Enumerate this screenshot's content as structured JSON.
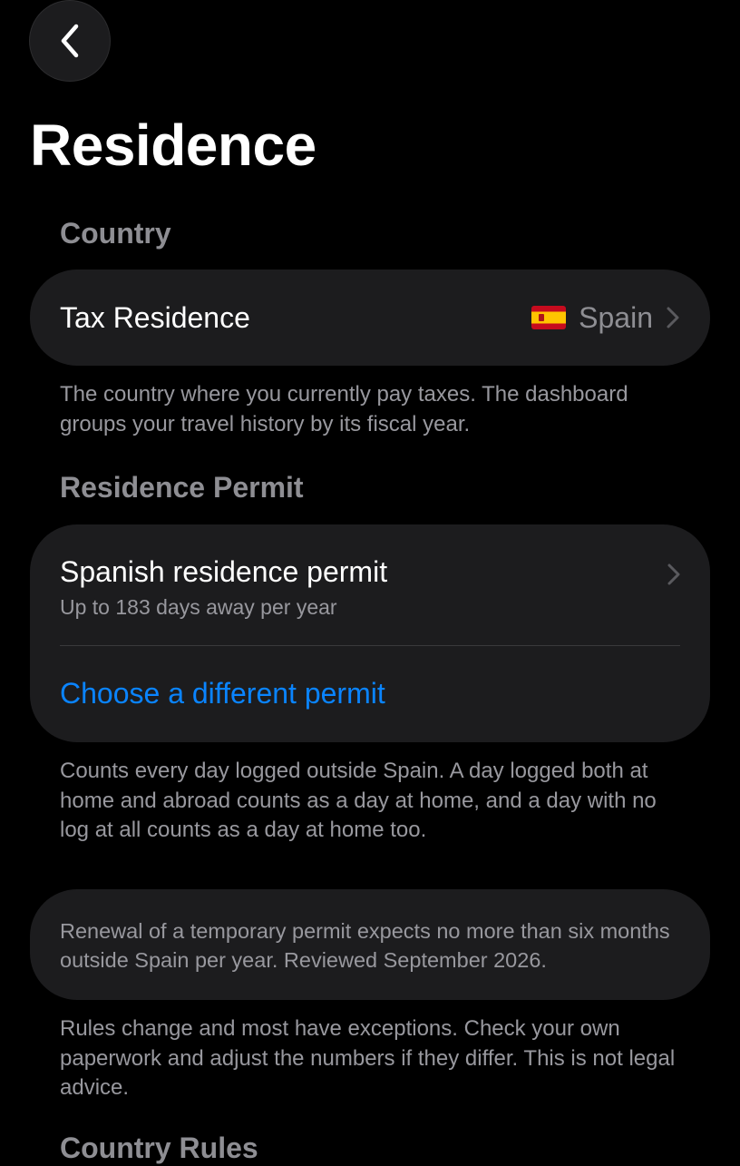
{
  "header": {
    "back_icon": "chevron-left-icon",
    "title": "Residence"
  },
  "country_section": {
    "header": "Country",
    "tax_residence": {
      "label": "Tax Residence",
      "flag_icon": "spain-flag-icon",
      "value": "Spain",
      "chevron_icon": "chevron-right-icon"
    },
    "footnote": "The country where you currently pay taxes. The dashboard groups your travel history by its fiscal year."
  },
  "permit_section": {
    "header": "Residence Permit",
    "permit": {
      "name": "Spanish residence permit",
      "subtitle": "Up to 183 days away per year",
      "chevron_icon": "chevron-right-icon"
    },
    "change_link": "Choose a different permit",
    "footnote": "Counts every day logged outside Spain. A day logged both at home and abroad counts as a day at home, and a day with no log at all counts as a day at home too."
  },
  "info_card": {
    "text": "Renewal of a temporary permit expects no more than six months outside Spain per year. Reviewed September 2026."
  },
  "disclaimer": "Rules change and most have exceptions. Check your own paperwork and adjust the numbers if they differ. This is not legal advice.",
  "next_section": {
    "header": "Country Rules"
  },
  "colors": {
    "background": "#000000",
    "card": "#1c1c1e",
    "secondary_text": "#98989e",
    "accent": "#0a84ff"
  }
}
